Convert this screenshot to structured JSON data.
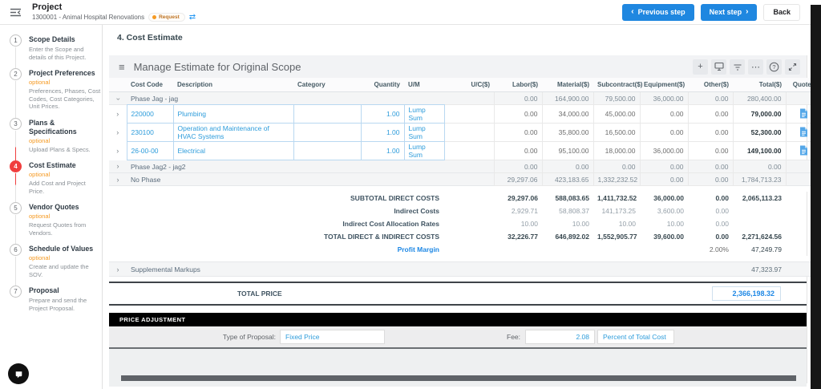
{
  "colors": {
    "accent": "#1f87e0",
    "link_blue": "#2d9cdb",
    "active_step_red": "#f03e3e",
    "badge_orange": "#f59a23"
  },
  "icons": {
    "menu": "≡",
    "sync": "⇄",
    "add": "+",
    "more": "⋯",
    "help": "?",
    "prev_chevron": "‹",
    "next_chevron": "›",
    "chevron": "›"
  },
  "header": {
    "title": "Project",
    "subtitle": "1300001 - Animal Hospital Renovations",
    "badge": "Request",
    "prev_button": "Previous step",
    "next_button": "Next step",
    "back_button": "Back"
  },
  "sidebar": {
    "steps": [
      {
        "num": "1",
        "label": "Scope Details",
        "tag": null,
        "desc": "Enter the Scope and details of this Project.",
        "active": false
      },
      {
        "num": "2",
        "label": "Project Preferences",
        "tag": "optional",
        "desc": "Preferences, Phases, Cost Codes, Cost Categories, Unit Prices.",
        "active": false
      },
      {
        "num": "3",
        "label": "Plans & Specifications",
        "tag": "optional",
        "desc": "Upload Plans & Specs.",
        "active": false
      },
      {
        "num": "4",
        "label": "Cost Estimate",
        "tag": "optional",
        "desc": "Add Cost and Project Price.",
        "active": true
      },
      {
        "num": "5",
        "label": "Vendor Quotes",
        "tag": "optional",
        "desc": "Request Quotes from Vendors.",
        "active": false
      },
      {
        "num": "6",
        "label": "Schedule of Values",
        "tag": "optional",
        "desc": "Create and update the SOV.",
        "active": false
      },
      {
        "num": "7",
        "label": "Proposal",
        "tag": null,
        "desc": "Prepare and send the Project Proposal.",
        "active": false
      }
    ]
  },
  "main": {
    "section_title": "4. Cost Estimate",
    "card_title": "Manage Estimate for Original Scope"
  },
  "table": {
    "columns": [
      "",
      "Cost Code",
      "Description",
      "Category",
      "Quantity",
      "U/M",
      "U/C($)",
      "Labor($)",
      "Material($)",
      "Subcontract($)",
      "Equipment($)",
      "Other($)",
      "Total($)",
      "Quotes"
    ],
    "rows": [
      {
        "type": "group",
        "expanded": true,
        "label": "Phase Jag - jag",
        "labor": "0.00",
        "material": "164,900.00",
        "subcontract": "79,500.00",
        "equipment": "36,000.00",
        "other": "0.00",
        "total": "280,400.00"
      },
      {
        "type": "item",
        "costCode": "220000",
        "description": "Plumbing",
        "category": "",
        "quantity": "1.00",
        "um": "Lump Sum",
        "uc": "",
        "labor": "0.00",
        "material": "34,000.00",
        "subcontract": "45,000.00",
        "equipment": "0.00",
        "other": "0.00",
        "total": "79,000.00",
        "quotes": true
      },
      {
        "type": "item",
        "costCode": "230100",
        "description": "Operation and Maintenance of HVAC Systems",
        "category": "",
        "quantity": "1.00",
        "um": "Lump Sum",
        "uc": "",
        "labor": "0.00",
        "material": "35,800.00",
        "subcontract": "16,500.00",
        "equipment": "0.00",
        "other": "0.00",
        "total": "52,300.00",
        "quotes": true
      },
      {
        "type": "item",
        "costCode": "26-00-00",
        "description": "Electrical",
        "category": "",
        "quantity": "1.00",
        "um": "Lump Sum",
        "uc": "",
        "labor": "0.00",
        "material": "95,100.00",
        "subcontract": "18,000.00",
        "equipment": "36,000.00",
        "other": "0.00",
        "total": "149,100.00",
        "quotes": true
      },
      {
        "type": "group",
        "expanded": false,
        "label": "Phase Jag2 - jag2",
        "labor": "0.00",
        "material": "0.00",
        "subcontract": "0.00",
        "equipment": "0.00",
        "other": "0.00",
        "total": "0.00"
      },
      {
        "type": "group",
        "expanded": false,
        "label": "No Phase",
        "labor": "29,297.06",
        "material": "423,183.65",
        "subcontract": "1,332,232.52",
        "equipment": "0.00",
        "other": "0.00",
        "total": "1,784,713.23"
      }
    ],
    "summary": [
      {
        "style": "strong",
        "label": "SUBTOTAL DIRECT COSTS",
        "labor": "29,297.06",
        "material": "588,083.65",
        "subcontract": "1,411,732.52",
        "equipment": "36,000.00",
        "other": "0.00",
        "total": "2,065,113.23"
      },
      {
        "style": "muted",
        "label": "Indirect Costs",
        "labor": "2,929.71",
        "material": "58,808.37",
        "subcontract": "141,173.25",
        "equipment": "3,600.00",
        "other": "0.00",
        "total": ""
      },
      {
        "style": "muted",
        "label": "Indirect Cost Allocation Rates",
        "labor": "10.00",
        "material": "10.00",
        "subcontract": "10.00",
        "equipment": "10.00",
        "other": "0.00",
        "total": ""
      },
      {
        "style": "strong",
        "label": "TOTAL DIRECT & INDIRECT COSTS",
        "labor": "32,226.77",
        "material": "646,892.02",
        "subcontract": "1,552,905.77",
        "equipment": "39,600.00",
        "other": "0.00",
        "total": "2,271,624.56"
      },
      {
        "style": "link",
        "label": "Profit Margin",
        "labor": "",
        "material": "",
        "subcontract": "",
        "equipment": "",
        "other": "2.00%",
        "total": "47,249.79"
      }
    ],
    "supplemental": {
      "label": "Supplemental Markups",
      "total": "47,323.97"
    },
    "total_price": {
      "label": "TOTAL PRICE",
      "value": "2,366,198.32"
    },
    "price_adjustment": {
      "title": "PRICE ADJUSTMENT",
      "type_label": "Type of Proposal:",
      "type_value": "Fixed Price",
      "fee_label": "Fee:",
      "fee_value": "2.08",
      "fee_unit": "Percent of Total Cost"
    }
  }
}
